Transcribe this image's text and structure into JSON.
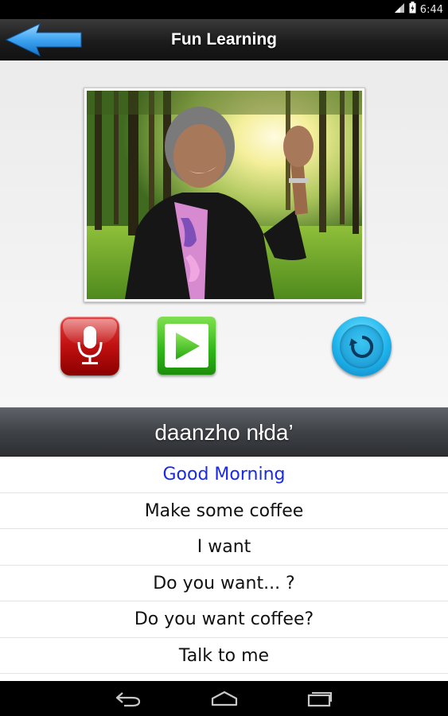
{
  "status_bar": {
    "time": "6:44",
    "icons": [
      "signal-icon",
      "battery-icon"
    ]
  },
  "header": {
    "title": "Fun Learning",
    "back_icon": "back-arrow-icon"
  },
  "media": {
    "photo": "woman-waving-in-forest-photo",
    "controls": [
      "microphone-icon",
      "play-icon",
      "replay-icon"
    ]
  },
  "word": {
    "native": "daanzho nłda’"
  },
  "phrases": [
    {
      "text": "Good Morning",
      "selected": true
    },
    {
      "text": "Make some coffee",
      "selected": false
    },
    {
      "text": "I want",
      "selected": false
    },
    {
      "text": "Do you want... ?",
      "selected": false
    },
    {
      "text": "Do you want coffee?",
      "selected": false
    },
    {
      "text": "Talk to me",
      "selected": false
    }
  ],
  "nav": [
    "back-nav-icon",
    "home-nav-icon",
    "recent-apps-icon"
  ],
  "colors": {
    "selected_phrase": "#1a29e8",
    "accent_blue": "#1fb4ec",
    "record_red": "#c01010",
    "play_green": "#2fb518"
  }
}
